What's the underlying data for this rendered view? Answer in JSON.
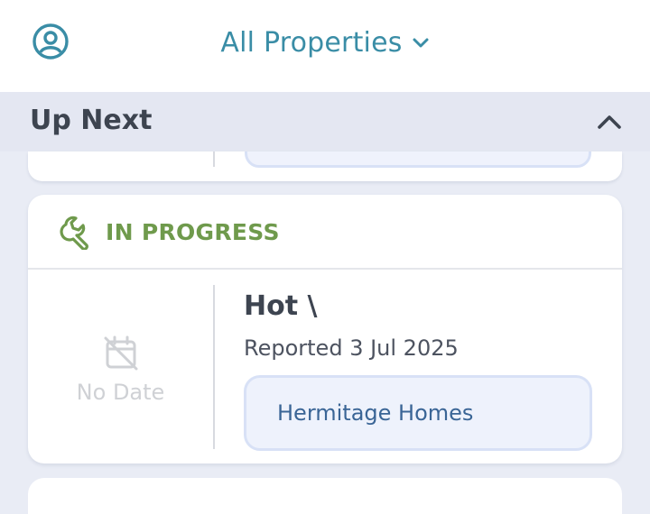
{
  "header": {
    "profile_icon": "account-circle-icon",
    "filter_label": "All Properties",
    "filter_icon": "chevron-down-icon"
  },
  "section": {
    "title": "Up Next",
    "collapse_icon": "chevron-up-icon"
  },
  "card": {
    "status_icon": "wrench-icon",
    "status_label": "IN PROGRESS",
    "date_icon": "calendar-off-icon",
    "date_label": "No Date",
    "title": "Hot \\",
    "reported": "Reported 3 Jul 2025",
    "property": "Hermitage Homes"
  },
  "colors": {
    "accent": "#3a8da6",
    "status_in_progress": "#6f9a4c",
    "chip_text": "#3a6596",
    "chip_bg": "#eef2fc"
  }
}
